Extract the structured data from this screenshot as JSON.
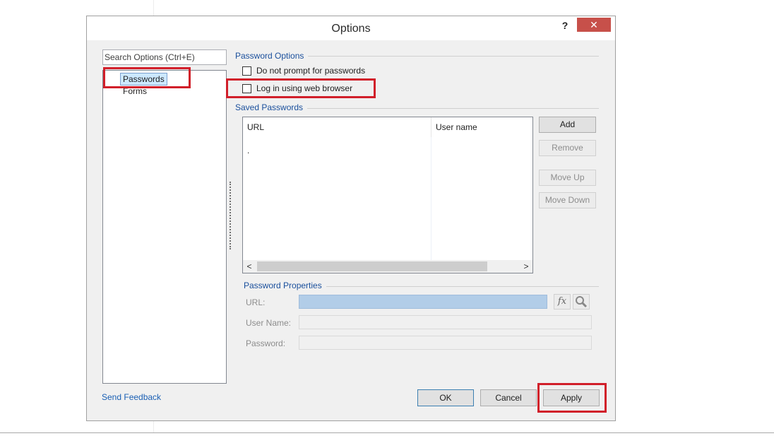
{
  "dialog": {
    "title": "Options",
    "help_label": "?",
    "close_label": "✕"
  },
  "sidebar": {
    "search_placeholder": "Search Options (Ctrl+E)",
    "items": [
      {
        "label": "Passwords",
        "selected": true
      },
      {
        "label": "Forms",
        "selected": false
      }
    ],
    "feedback_link": "Send Feedback"
  },
  "password_options": {
    "group_label": "Password Options",
    "checkboxes": [
      {
        "label": "Do not prompt for passwords",
        "checked": false
      },
      {
        "label": "Log in using web browser",
        "checked": false
      }
    ]
  },
  "saved_passwords": {
    "group_label": "Saved Passwords",
    "columns": [
      "URL",
      "User name"
    ],
    "rows": [
      {
        "url": ".",
        "user": ""
      }
    ],
    "scroll_left": "<",
    "scroll_right": ">",
    "buttons": {
      "add": "Add",
      "remove": "Remove",
      "move_up": "Move  Up",
      "move_down": "Move Down"
    }
  },
  "properties": {
    "group_label": "Password Properties",
    "url_label": "URL:",
    "username_label": "User Name:",
    "password_label": "Password:",
    "fx_icon": "fx"
  },
  "footer": {
    "ok": "OK",
    "cancel": "Cancel",
    "apply": "Apply"
  },
  "colors": {
    "highlight": "#d11f2a",
    "link": "#1a5fb4",
    "selection": "#cce8ff",
    "url_field": "#b2cde8"
  }
}
